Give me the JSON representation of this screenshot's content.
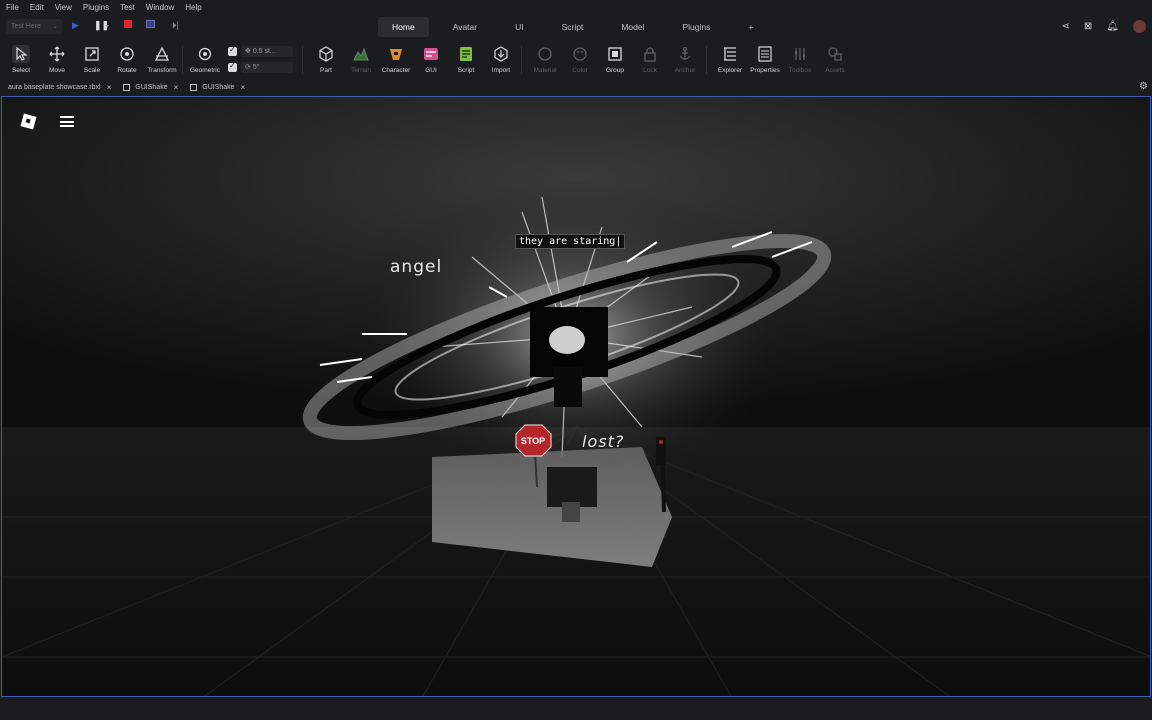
{
  "menu": [
    "File",
    "Edit",
    "View",
    "Plugins",
    "Test",
    "Window",
    "Help"
  ],
  "topbar": {
    "test_selector": "Test Here",
    "tabs": [
      {
        "label": "Home",
        "active": true
      },
      {
        "label": "Avatar",
        "active": false
      },
      {
        "label": "UI",
        "active": false
      },
      {
        "label": "Script",
        "active": false
      },
      {
        "label": "Model",
        "active": false
      },
      {
        "label": "Plugins",
        "active": false
      },
      {
        "label": "+",
        "active": false
      }
    ]
  },
  "ribbon": {
    "select": "Select",
    "move": "Move",
    "scale": "Scale",
    "rotate": "Rotate",
    "transform": "Transform",
    "geometric": "Geometric",
    "snap_move": "0.5 st...",
    "snap_rotate": "5°",
    "part": "Part",
    "terrain": "Terrain",
    "character": "Character",
    "gui": "GUI",
    "script": "Script",
    "import": "Import",
    "material": "Material",
    "color": "Color",
    "group": "Group",
    "lock": "Lock",
    "anchor": "Anchor",
    "explorer": "Explorer",
    "properties": "Properties",
    "toolbox": "Toolbox",
    "assets": "Assets"
  },
  "file_tabs": [
    {
      "label": "aura baseplate showcase.rbxl"
    },
    {
      "label": "GUIShake"
    },
    {
      "label": "GUIShake"
    }
  ],
  "viewport": {
    "text_staring": "they are staring|",
    "text_angel": "angel",
    "text_lost": "lost?",
    "sign_text": "STOP"
  },
  "colors": {
    "accent_blue": "#3f5fb0",
    "stop_red": "#b3262c",
    "record_red": "#e0262c",
    "play_blue": "#3d5bd9",
    "character_orange": "#e08a2e",
    "gui_pink": "#d54f8c",
    "script_green": "#7cc043"
  }
}
